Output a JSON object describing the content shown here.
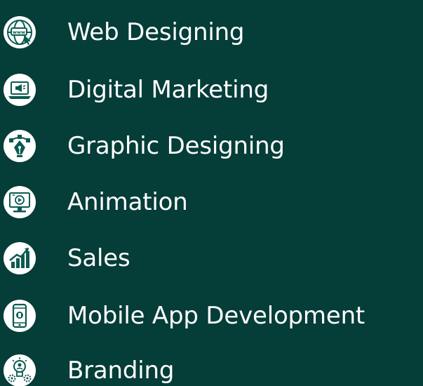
{
  "services": [
    {
      "label": "Web Designing",
      "icon": "globe-www-icon"
    },
    {
      "label": "Digital Marketing",
      "icon": "laptop-megaphone-icon"
    },
    {
      "label": "Graphic Designing",
      "icon": "pen-tool-icon"
    },
    {
      "label": "Animation",
      "icon": "monitor-play-icon"
    },
    {
      "label": "Sales",
      "icon": "growth-chart-icon"
    },
    {
      "label": "Mobile App Development",
      "icon": "smartphone-icon"
    },
    {
      "label": "Branding",
      "icon": "lightbulb-gears-icon"
    }
  ],
  "colors": {
    "background": "#053d38",
    "icon_fill": "#ffffff",
    "icon_line": "#0b5a50",
    "text": "#ffffff"
  }
}
